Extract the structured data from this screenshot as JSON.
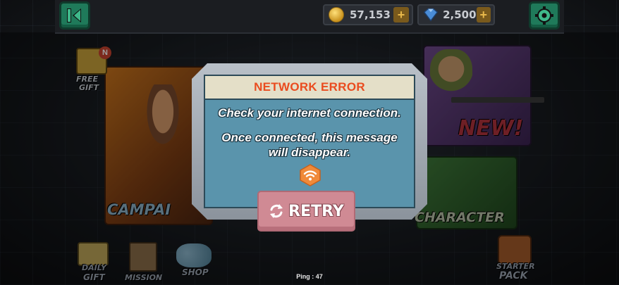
{
  "topbar": {
    "back_icon": "back-arrow-icon",
    "coins": {
      "amount": "57,153",
      "icon": "coin-icon",
      "plus": "+"
    },
    "gems": {
      "amount": "2,500",
      "icon": "diamond-icon",
      "plus": "+"
    },
    "settings_icon": "gear-icon"
  },
  "menu": {
    "free_gift": {
      "label_line1": "FREE",
      "label_line2": "GIFT",
      "badge": "N"
    },
    "campaign": {
      "label": "CAMPAI"
    },
    "new_badge": "NEW!",
    "character": {
      "label": "CHARACTER"
    },
    "daily_gift": {
      "label_line1": "DAILY",
      "label_line2": "GIFT"
    },
    "mission": {
      "label": "MISSION"
    },
    "shop": {
      "label": "SHOP"
    },
    "starter_pack": {
      "label_line1": "STARTER",
      "label_line2": "PACK"
    }
  },
  "dialog": {
    "title": "NETWORK ERROR",
    "message_line1": "Check your internet connection.",
    "message_line2a": "Once connected, this message",
    "message_line2b": "will disappear.",
    "status_icon": "wifi-icon",
    "retry_label": "RETRY",
    "retry_icon": "refresh-icon"
  },
  "footer": {
    "ping": "Ping : 47"
  },
  "colors": {
    "title": "#ea4c1f",
    "dialog_body": "#5a94ac",
    "retry_button": "#d08a94",
    "accent_green": "#1f7a5a"
  }
}
